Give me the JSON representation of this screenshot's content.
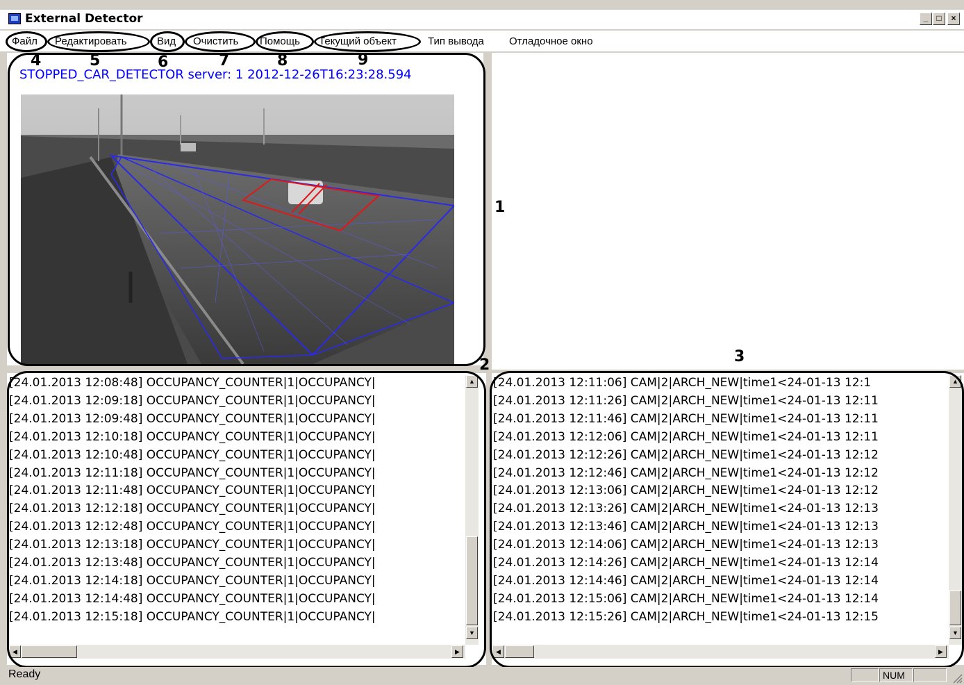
{
  "window": {
    "title": "External Detector",
    "minimize_label": "_",
    "maximize_label": "□",
    "close_label": "×"
  },
  "menu": [
    "Файл",
    "Редактировать",
    "Вид",
    "Очистить",
    "Помощь",
    "Текущий объект",
    "Тип вывода",
    "Отладочное окно"
  ],
  "callouts": {
    "file": "4",
    "edit": "5",
    "view": "6",
    "clear": "7",
    "help": "8",
    "current_object": "9",
    "video_area": "1",
    "left_log": "2",
    "right_log": "3"
  },
  "video": {
    "header": "STOPPED_CAR_DETECTOR server: 1 2012-12-26T16:23:28.594"
  },
  "left_log": [
    "[24.01.2013 12:08:48] OCCUPANCY_COUNTER|1|OCCUPANCY|",
    "[24.01.2013 12:09:18] OCCUPANCY_COUNTER|1|OCCUPANCY|",
    "[24.01.2013 12:09:48] OCCUPANCY_COUNTER|1|OCCUPANCY|",
    "[24.01.2013 12:10:18] OCCUPANCY_COUNTER|1|OCCUPANCY|",
    "[24.01.2013 12:10:48] OCCUPANCY_COUNTER|1|OCCUPANCY|",
    "[24.01.2013 12:11:18] OCCUPANCY_COUNTER|1|OCCUPANCY|",
    "[24.01.2013 12:11:48] OCCUPANCY_COUNTER|1|OCCUPANCY|",
    "[24.01.2013 12:12:18] OCCUPANCY_COUNTER|1|OCCUPANCY|",
    "[24.01.2013 12:12:48] OCCUPANCY_COUNTER|1|OCCUPANCY|",
    "[24.01.2013 12:13:18] OCCUPANCY_COUNTER|1|OCCUPANCY|",
    "[24.01.2013 12:13:48] OCCUPANCY_COUNTER|1|OCCUPANCY|",
    "[24.01.2013 12:14:18] OCCUPANCY_COUNTER|1|OCCUPANCY|",
    "[24.01.2013 12:14:48] OCCUPANCY_COUNTER|1|OCCUPANCY|",
    "[24.01.2013 12:15:18] OCCUPANCY_COUNTER|1|OCCUPANCY|"
  ],
  "right_log": [
    "[24.01.2013 12:11:06] CAM|2|ARCH_NEW|time1<24-01-13 12:1",
    "[24.01.2013 12:11:26] CAM|2|ARCH_NEW|time1<24-01-13 12:11",
    "[24.01.2013 12:11:46] CAM|2|ARCH_NEW|time1<24-01-13 12:11",
    "[24.01.2013 12:12:06] CAM|2|ARCH_NEW|time1<24-01-13 12:11",
    "[24.01.2013 12:12:26] CAM|2|ARCH_NEW|time1<24-01-13 12:12",
    "[24.01.2013 12:12:46] CAM|2|ARCH_NEW|time1<24-01-13 12:12",
    "[24.01.2013 12:13:06] CAM|2|ARCH_NEW|time1<24-01-13 12:12",
    "[24.01.2013 12:13:26] CAM|2|ARCH_NEW|time1<24-01-13 12:13",
    "[24.01.2013 12:13:46] CAM|2|ARCH_NEW|time1<24-01-13 12:13",
    "[24.01.2013 12:14:06] CAM|2|ARCH_NEW|time1<24-01-13 12:13",
    "[24.01.2013 12:14:26] CAM|2|ARCH_NEW|time1<24-01-13 12:14",
    "[24.01.2013 12:14:46] CAM|2|ARCH_NEW|time1<24-01-13 12:14",
    "[24.01.2013 12:15:06] CAM|2|ARCH_NEW|time1<24-01-13 12:14",
    "[24.01.2013 12:15:26] CAM|2|ARCH_NEW|time1<24-01-13 12:15"
  ],
  "status": {
    "text": "Ready",
    "num": "NUM"
  },
  "colors": {
    "header_text": "#0000ff",
    "zone_outline": "#2a2ae8",
    "detection_box": "#e01818"
  }
}
